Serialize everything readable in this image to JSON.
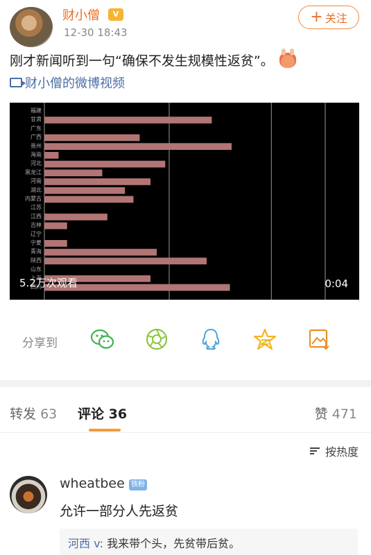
{
  "post": {
    "author": "财小僧",
    "vip_label": "V",
    "time": "12-30 18:43",
    "follow_label": "关注",
    "text": "刚才新闻听到一句“确保不发生规模性返贫”。",
    "video_link": "财小僧的微博视频"
  },
  "video": {
    "views": "5.2万次观看",
    "duration": "0:04"
  },
  "chart_data": {
    "type": "bar",
    "orientation": "horizontal",
    "categories": [
      "福建",
      "甘肃",
      "广东",
      "广西",
      "贵州",
      "海南",
      "河北",
      "黑龙江",
      "河南",
      "湖北",
      "内蒙古",
      "江苏",
      "江西",
      "吉林",
      "辽宁",
      "宁夏",
      "青海",
      "陕西",
      "山东",
      "上海",
      "四川"
    ],
    "values": [
      0,
      295,
      0,
      168,
      330,
      25,
      213,
      102,
      187,
      142,
      157,
      0,
      111,
      40,
      0,
      40,
      198,
      286,
      0,
      187,
      327
    ],
    "xlim": [
      0,
      550
    ],
    "grid_x": [
      0,
      220,
      400,
      495
    ],
    "colors": {
      "bar": "#b27575",
      "background": "#000000",
      "label": "#aaaaaa",
      "grid": "#9a9a9a"
    }
  },
  "share": {
    "label": "分享到",
    "icons": [
      "wechat-icon",
      "moments-icon",
      "qq-icon",
      "qzone-icon",
      "save-image-icon"
    ]
  },
  "tabs": {
    "repost_label": "转发",
    "repost_count": "63",
    "comment_label": "评论",
    "comment_count": "36",
    "like_label": "赞",
    "like_count": "471"
  },
  "sort_label": "按热度",
  "comment": {
    "author": "wheatbee",
    "badge": "铁粉",
    "text": "允许一部分人先返贫",
    "reply_author": "河西 v:",
    "reply_text": "我来带个头，先贫带后贫。"
  }
}
